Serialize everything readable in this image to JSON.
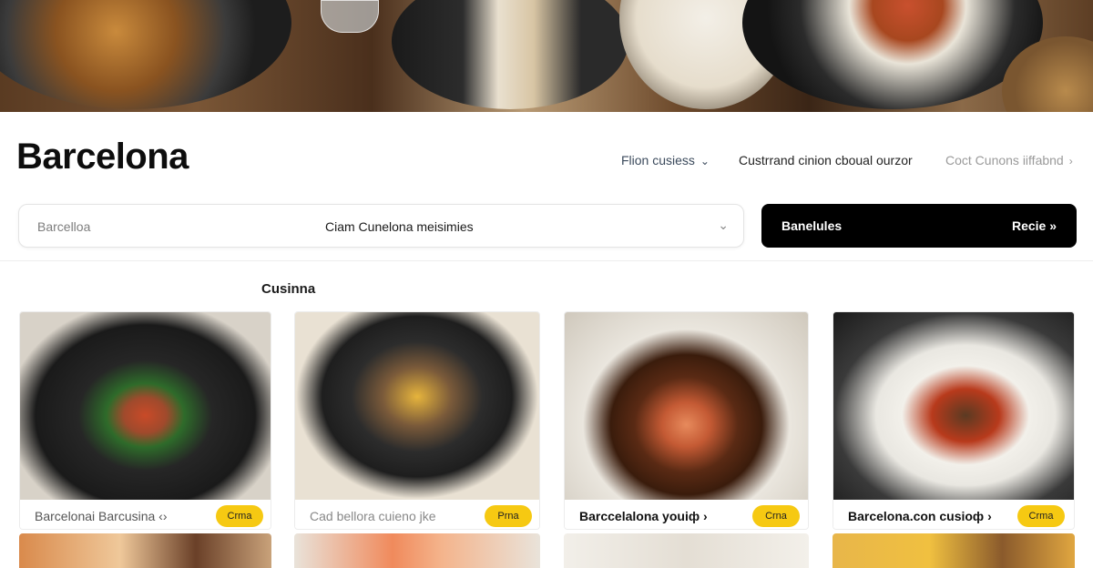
{
  "header": {
    "title": "Barcelona",
    "nav": [
      {
        "label": "Flion cusiess",
        "chevron": "chevron-down-icon"
      },
      {
        "label": "Custrrand cinion cboual ourzor",
        "chevron": ""
      },
      {
        "label": "Coct Cunons iiffabnd",
        "chevron": "chevron-right-icon"
      }
    ]
  },
  "search": {
    "location_value": "Barcelloa",
    "query_value": "Ciam Cunelona meisimies",
    "dropdown_icon": "chevron-down-icon"
  },
  "cta": {
    "label": "Banelules",
    "action": "Recie »"
  },
  "section": {
    "title": "Cusinna"
  },
  "cards": [
    {
      "name": "Barcelonai Barcusina ‹›",
      "badge": "Crma"
    },
    {
      "name": "Cad bellora cuieno jke",
      "badge": "Prna"
    },
    {
      "name": "Barccelalona youiф ›",
      "badge": "Crna"
    },
    {
      "name": "Barcelona.con cusioф ›",
      "badge": "Crma"
    }
  ],
  "colors": {
    "accent_badge": "#f6c912",
    "cta_background": "#000000"
  }
}
